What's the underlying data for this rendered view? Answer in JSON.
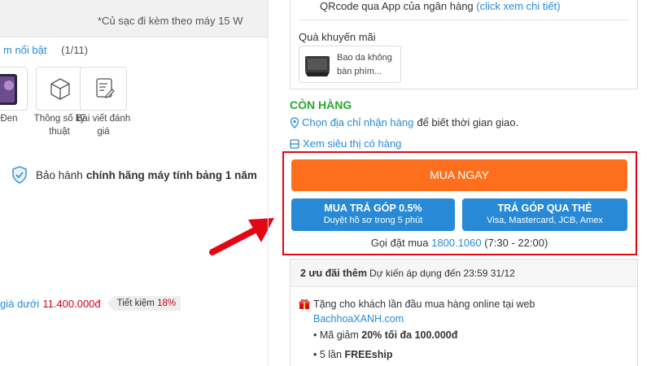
{
  "left": {
    "charger_note": "*Củ sạc đi kèm theo máy 15 W",
    "featured_link": "m nổi bật",
    "featured_count": "(1/11)",
    "thumbnails": [
      {
        "label": "Đen",
        "icon": "tablet-color-thumbnail"
      },
      {
        "label": "Thông số kỹ thuật",
        "icon": "cube-icon"
      },
      {
        "label": "Bài viết đánh giá",
        "icon": "article-edit-icon"
      }
    ],
    "warranty_prefix": "Bảo hành",
    "warranty_bold": "chính hãng máy tính bảng 1 năm",
    "price_label": "giá dưới",
    "price_value": "11.400.000đ",
    "save_label": "Tiết kiệm",
    "save_percent": "18%"
  },
  "right": {
    "qr_text": "QRcode qua App của ngân hàng",
    "qr_link": "(click xem chi tiết)",
    "gift_title": "Quà khuyến mãi",
    "gift_item_name": "Bao da không bàn phím...",
    "stock_status": "CÒN HÀNG",
    "address_link": "Chọn địa chỉ nhận hàng",
    "address_suffix": "để biết thời gian giao.",
    "store_link": "Xem siêu thị có hàng",
    "buy_now": "MUA NGAY",
    "installment_btn": {
      "title": "MUA TRẢ GÓP 0.5%",
      "subtitle": "Duyệt hồ sơ trong 5 phút"
    },
    "card_installment_btn": {
      "title": "TRẢ GÓP QUA THẺ",
      "subtitle": "Visa, Mastercard, JCB, Amex"
    },
    "hotline_label": "Gọi đặt mua",
    "hotline_number": "1800.1060",
    "hotline_hours": "(7:30 - 22:00)",
    "offers_count": "2 ưu đãi thêm",
    "offers_date": "Dự kiến áp dụng đến 23:59 31/12",
    "offer_line": "Tặng cho khách lần đầu mua hàng online tại web",
    "offer_site": "BachhoaXANH.com",
    "offer_bullets": [
      {
        "prefix": "Mã giảm",
        "bold": "20% tối đa 100.000đ",
        "suffix": ""
      },
      {
        "prefix": "5 lần",
        "bold": "FREEship",
        "suffix": ""
      }
    ]
  },
  "colors": {
    "accent_blue": "#288ad6",
    "buy_orange": "#fd6e1d",
    "stock_green": "#2ba832",
    "highlight_red": "#e30613",
    "price_red": "#d0021b"
  }
}
